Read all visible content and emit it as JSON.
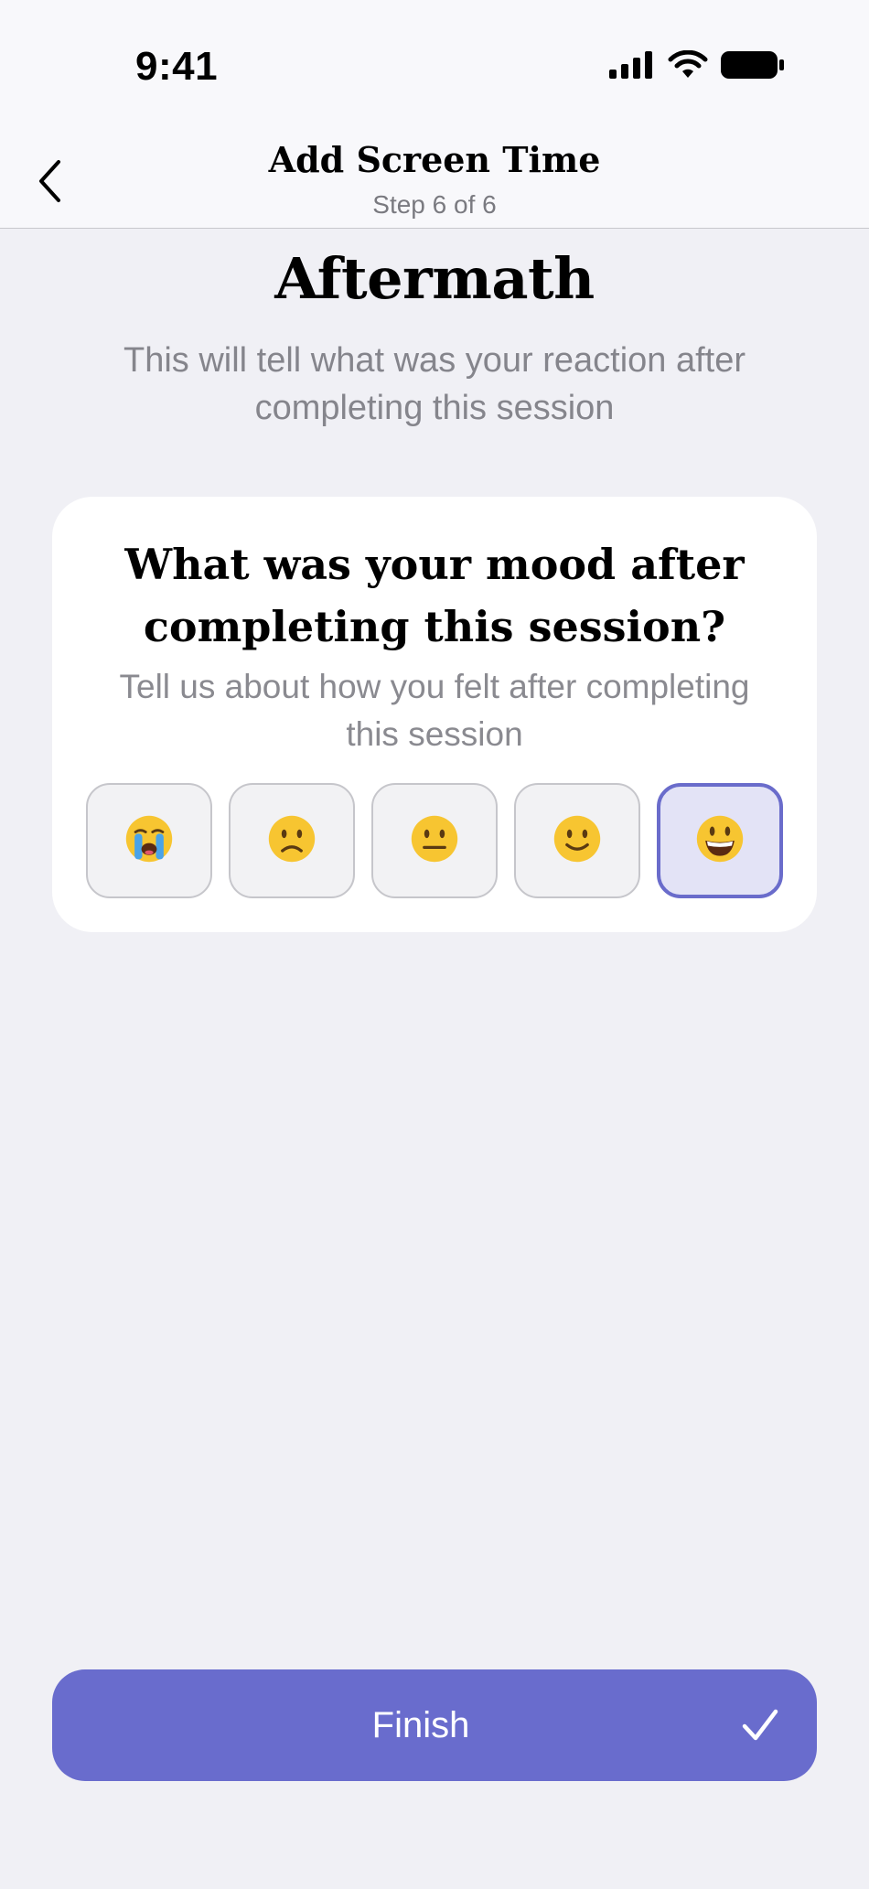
{
  "status_bar": {
    "time": "9:41",
    "icons": [
      "cellular-signal-icon",
      "wifi-icon",
      "battery-icon"
    ]
  },
  "header": {
    "back_icon": "chevron-left-icon",
    "title": "Add Screen Time",
    "step": "Step 6 of 6"
  },
  "section": {
    "title": "Aftermath",
    "subtitle": "This will tell what was your reaction after completing this session"
  },
  "mood_card": {
    "question": "What was your mood after completing this session?",
    "hint": "Tell us about how you felt after completing this session",
    "options": [
      {
        "icon": "crying-face-icon",
        "selected": false
      },
      {
        "icon": "slightly-frowning-face-icon",
        "selected": false
      },
      {
        "icon": "neutral-face-icon",
        "selected": false
      },
      {
        "icon": "slightly-smiling-face-icon",
        "selected": false
      },
      {
        "icon": "grinning-face-icon",
        "selected": true
      }
    ]
  },
  "finish_button": {
    "label": "Finish",
    "icon": "checkmark-icon"
  },
  "colors": {
    "accent": "#696ccd",
    "background": "#f0f0f5",
    "card": "#ffffff",
    "muted_text": "#85858c",
    "selected_tile": "#e3e3f6"
  }
}
